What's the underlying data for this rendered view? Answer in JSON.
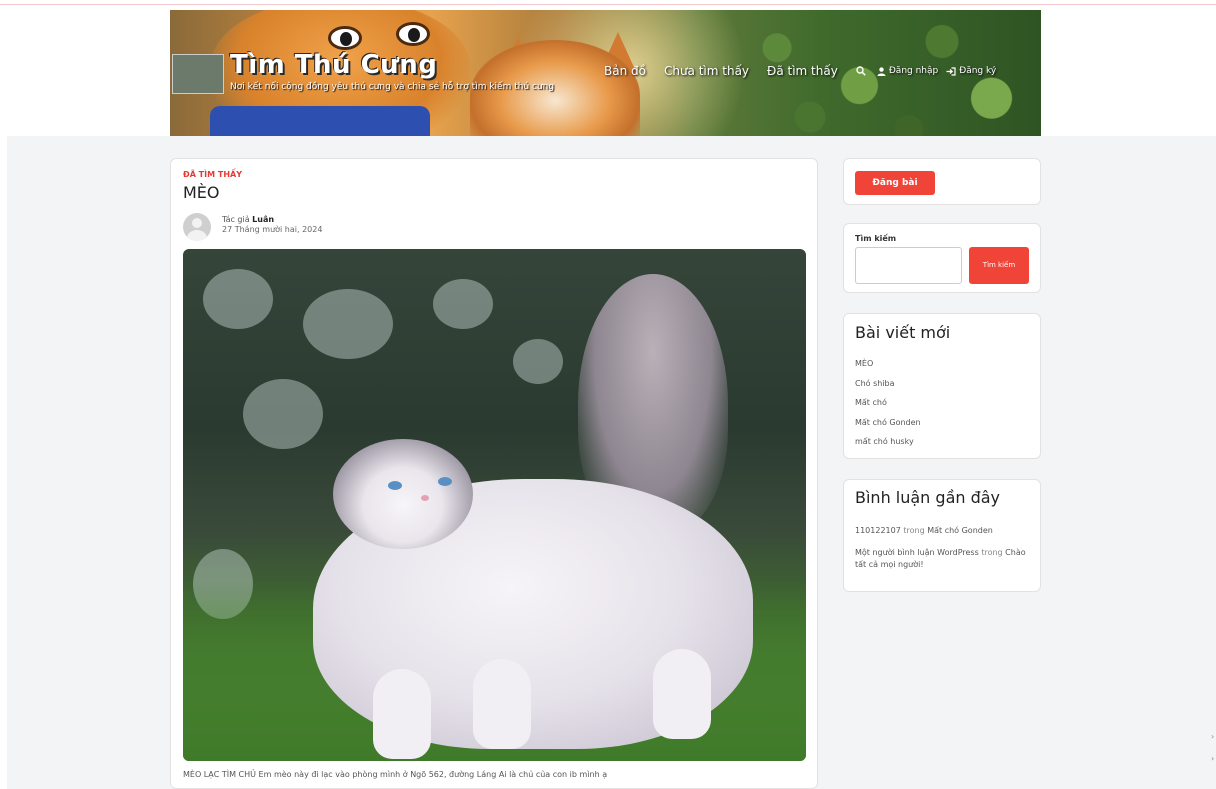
{
  "header": {
    "site_title": "Tìm Thú Cưng",
    "tagline": "Nơi kết nối cộng đồng yêu thú cưng và chia sẻ hỗ trợ tìm kiếm thú cưng",
    "nav": {
      "map": "Bản đồ",
      "not_found": "Chưa tìm thấy",
      "found": "Đã tìm thấy",
      "login": "Đăng nhập",
      "register": "Đăng ký"
    },
    "icons": {
      "search": "search-icon",
      "user": "user-icon",
      "login": "login-icon"
    }
  },
  "post": {
    "category": "ĐÃ TÌM THẤY",
    "title": "MÈO",
    "author_prefix": "Tác giả",
    "author": "Luân",
    "date": "27 Tháng mười hai, 2024",
    "excerpt": "MÈO LẠC TÌM CHỦ Em mèo này đi lạc vào phòng mình ở Ngõ 562, đường Láng Ai là chủ của con ib mình ạ"
  },
  "sidebar": {
    "post_button": "Đăng bài",
    "search": {
      "label": "Tìm kiếm",
      "placeholder": "",
      "button": "Tìm kiếm"
    },
    "recent_posts": {
      "title": "Bài viết mới",
      "items": [
        "MÈO",
        "Chó shiba",
        "Mất chó",
        "Mất chó Gonden",
        "mất chó husky"
      ]
    },
    "recent_comments": {
      "title": "Bình luận gần đây",
      "items": [
        {
          "author": "110122107",
          "connector": "trong",
          "post": "Mất chó Gonden"
        },
        {
          "author": "Một người bình luận WordPress",
          "connector": "trong",
          "post": "Chào tất cả mọi người!"
        }
      ]
    }
  },
  "colors": {
    "accent": "#f04438",
    "category": "#e53935",
    "page_bg": "#f3f4f6"
  }
}
